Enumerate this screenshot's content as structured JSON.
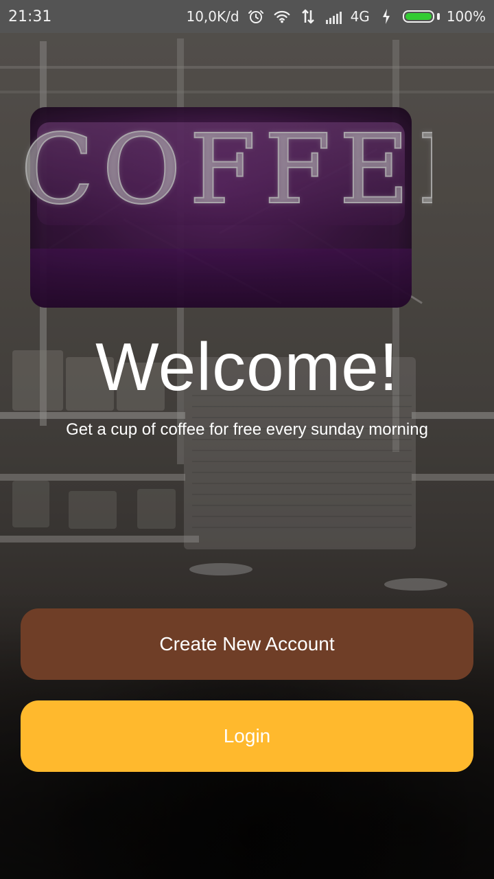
{
  "status_bar": {
    "time": "21:31",
    "network_speed": "10,0K/d",
    "network_type": "4G",
    "battery": "100%",
    "icons": [
      "alarm-icon",
      "wifi-icon",
      "data-transfer-icon",
      "signal-icon",
      "charging-icon",
      "battery-icon"
    ],
    "battery_color": "#33cc33"
  },
  "hero": {
    "title": "Welcome!",
    "subtitle": "Get a cup of coffee for free every sunday morning",
    "background_sign_text": "COFFEE"
  },
  "actions": {
    "create_account_label": "Create New Account",
    "login_label": "Login",
    "create_account_color": "#6f3e27",
    "login_color": "#ffb92d"
  }
}
